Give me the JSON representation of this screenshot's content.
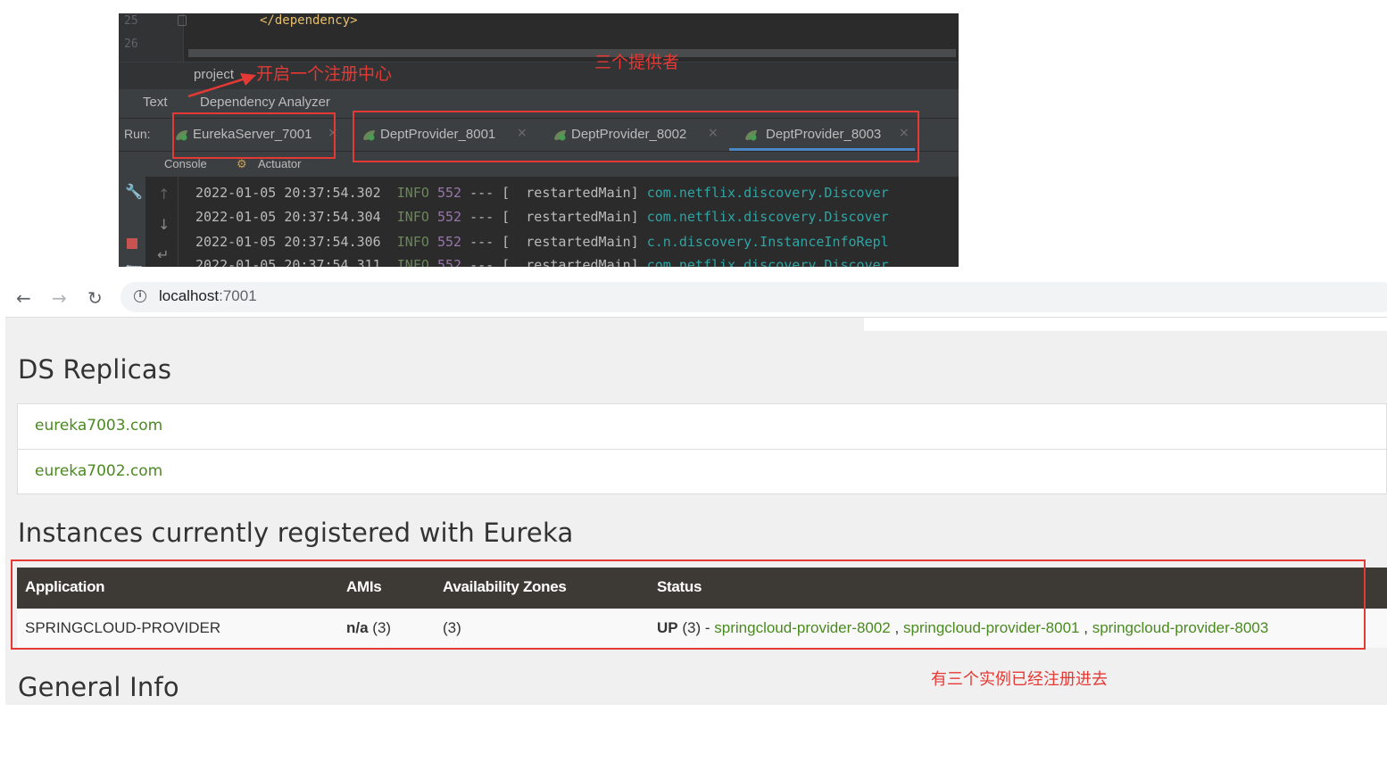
{
  "ide": {
    "code": {
      "line_numbers": [
        "25",
        "26"
      ],
      "line25_text": "</dependency>"
    },
    "breadcrumb": "project",
    "editor_tabs": [
      "Text",
      "Dependency Analyzer"
    ],
    "run": {
      "label": "Run:",
      "tabs": [
        {
          "label": "EurekaServer_7001",
          "active": false
        },
        {
          "label": "DeptProvider_8001",
          "active": false
        },
        {
          "label": "DeptProvider_8002",
          "active": false
        },
        {
          "label": "DeptProvider_8003",
          "active": true
        }
      ],
      "close_glyph": "×"
    },
    "subtabs": [
      "Console",
      "Actuator"
    ],
    "log_lines": [
      {
        "ts": "2022-01-05 20:37:54.302",
        "level": "INFO",
        "pid": "552",
        "sep": "--- [",
        "thread": "restartedMain]",
        "logger": "com.netflix.discovery.Discover"
      },
      {
        "ts": "2022-01-05 20:37:54.304",
        "level": "INFO",
        "pid": "552",
        "sep": "--- [",
        "thread": "restartedMain]",
        "logger": "com.netflix.discovery.Discover"
      },
      {
        "ts": "2022-01-05 20:37:54.306",
        "level": "INFO",
        "pid": "552",
        "sep": "--- [",
        "thread": "restartedMain]",
        "logger": "c.n.discovery.InstanceInfoRepl"
      },
      {
        "ts": "2022-01-05 20:37:54.311",
        "level": "INFO",
        "pid": "552",
        "sep": "--- [",
        "thread": "restartedMain]",
        "logger": "com.netflix.discovery.Discover"
      }
    ]
  },
  "annotations": {
    "registry_center": "开启一个注册中心",
    "three_providers": "三个提供者",
    "three_instances": "有三个实例已经注册进去"
  },
  "browser": {
    "url_host": "localhost",
    "url_port": ":7001",
    "ds_replicas_title": "DS Replicas",
    "replicas": [
      "eureka7003.com",
      "eureka7002.com"
    ],
    "instances_title": "Instances currently registered with Eureka",
    "table": {
      "headers": [
        "Application",
        "AMIs",
        "Availability Zones",
        "Status"
      ],
      "row": {
        "application": "SPRINGCLOUD-PROVIDER",
        "amis_main": "n/a",
        "amis_count": "(3)",
        "zones": "(3)",
        "status_main": "UP",
        "status_count": "(3) -",
        "instances": [
          "springcloud-provider-8002",
          "springcloud-provider-8001",
          "springcloud-provider-8003"
        ],
        "separator": ","
      }
    },
    "general_info_title": "General Info"
  },
  "colors": {
    "annotation_red": "#e53935",
    "link_green": "#4a8a20",
    "table_header_bg": "#3d3935"
  }
}
